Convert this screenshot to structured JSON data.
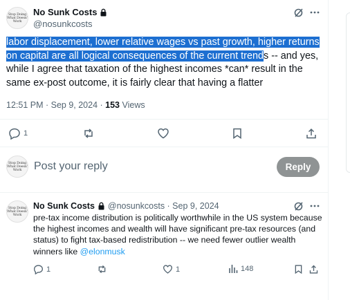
{
  "main_tweet": {
    "display_name": "No Sunk Costs",
    "handle": "@nosunkcosts",
    "text_selected": "labor displacement, lower relative wages vs past growth, higher returns on capital are all logical consequences of the current trend",
    "text_rest": "s -- and yes, while I agree that taxation of the highest incomes *can* result in the same ex-post outcome, it is fairly clear that having a flatter",
    "timestamp": "12:51 PM · Sep 9, 2024 · ",
    "views_count": "153",
    "views_label": "Views",
    "reply_count": "1"
  },
  "avatar_text": "Stop Doing\nWhat Doesn't\nWork",
  "reply_composer": {
    "placeholder": "Post your reply",
    "button_label": "Reply"
  },
  "reply_tweet": {
    "display_name": "No Sunk Costs",
    "handle_date": "@nosunkcosts · Sep 9, 2024",
    "text": "pre-tax income distribution is politically worthwhile in the US system because the highest incomes and wealth will have significant pre-tax resources (and status) to fight tax-based redistribution -- we need fewer outlier wealth winners like ",
    "mention": "@elonmusk",
    "reply_count": "1",
    "like_count": "1",
    "views_count": "148"
  },
  "colors": {
    "selection": "#1d6fd1",
    "muted": "#536471",
    "link": "#1d9bf0",
    "reply_button_bg": "#8f9394"
  }
}
